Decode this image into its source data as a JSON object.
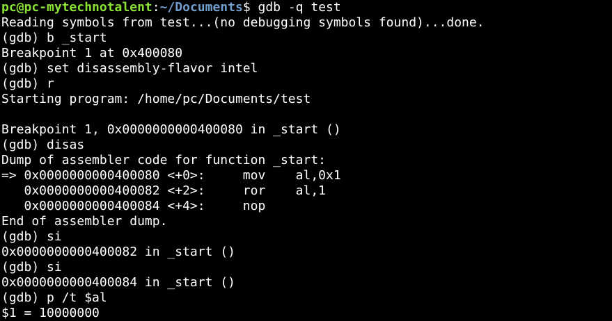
{
  "prompt": {
    "user_host": "pc@pc-mytechnotalent",
    "separator": ":",
    "path": "~/Documents",
    "symbol": "$",
    "command": " gdb -q test"
  },
  "lines": [
    "Reading symbols from test...(no debugging symbols found)...done.",
    "(gdb) b _start",
    "Breakpoint 1 at 0x400080",
    "(gdb) set disassembly-flavor intel",
    "(gdb) r",
    "Starting program: /home/pc/Documents/test",
    "",
    "Breakpoint 1, 0x0000000000400080 in _start ()",
    "(gdb) disas",
    "Dump of assembler code for function _start:",
    "=> 0x0000000000400080 <+0>:\tmov    al,0x1",
    "   0x0000000000400082 <+2>:\tror    al,1",
    "   0x0000000000400084 <+4>:\tnop",
    "End of assembler dump.",
    "(gdb) si",
    "0x0000000000400082 in _start ()",
    "(gdb) si",
    "0x0000000000400084 in _start ()",
    "(gdb) p /t $al",
    "$1 = 10000000"
  ]
}
